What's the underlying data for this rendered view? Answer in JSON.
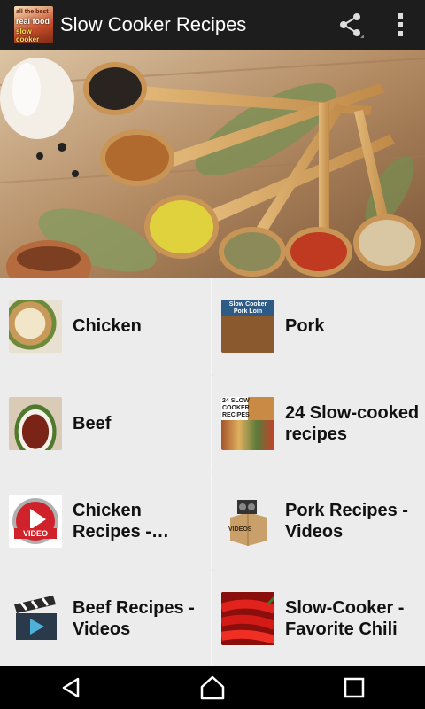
{
  "app_bar": {
    "title": "Slow Cooker Recipes",
    "logo_text": [
      "all the best",
      "real food",
      "slow cooker"
    ],
    "actions": [
      "share-icon",
      "overflow-menu-icon"
    ]
  },
  "hero": {
    "image": "spices-on-wooden-spoons"
  },
  "tiles": [
    {
      "label": "Chicken",
      "thumb": "chicken-dish-photo"
    },
    {
      "label": "Pork",
      "thumb": "pork-loin-photo",
      "thumb_text": "Slow Cooker Pork Loin"
    },
    {
      "label": "Beef",
      "thumb": "beef-stew-photo"
    },
    {
      "label": "24 Slow-cooked recipes",
      "thumb": "recipe-collage-photo",
      "thumb_text": "24 SLOW COOKER RECIPES"
    },
    {
      "label": "Chicken Recipes - Videos",
      "thumb": "video-play-icon",
      "thumb_text": "VIDEO"
    },
    {
      "label": "Pork Recipes - Videos",
      "thumb": "videos-box-icon",
      "thumb_text": "VIDEOS"
    },
    {
      "label": "Beef Recipes - Videos",
      "thumb": "clapperboard-icon"
    },
    {
      "label": "Slow-Cooker - Favorite Chili",
      "thumb": "red-chili-photo"
    }
  ],
  "nav": [
    "back-icon",
    "home-icon",
    "recents-icon"
  ],
  "colors": {
    "app_bar": "#1d1d1d",
    "grid_bg": "#ececec",
    "nav_bar": "#000000"
  }
}
